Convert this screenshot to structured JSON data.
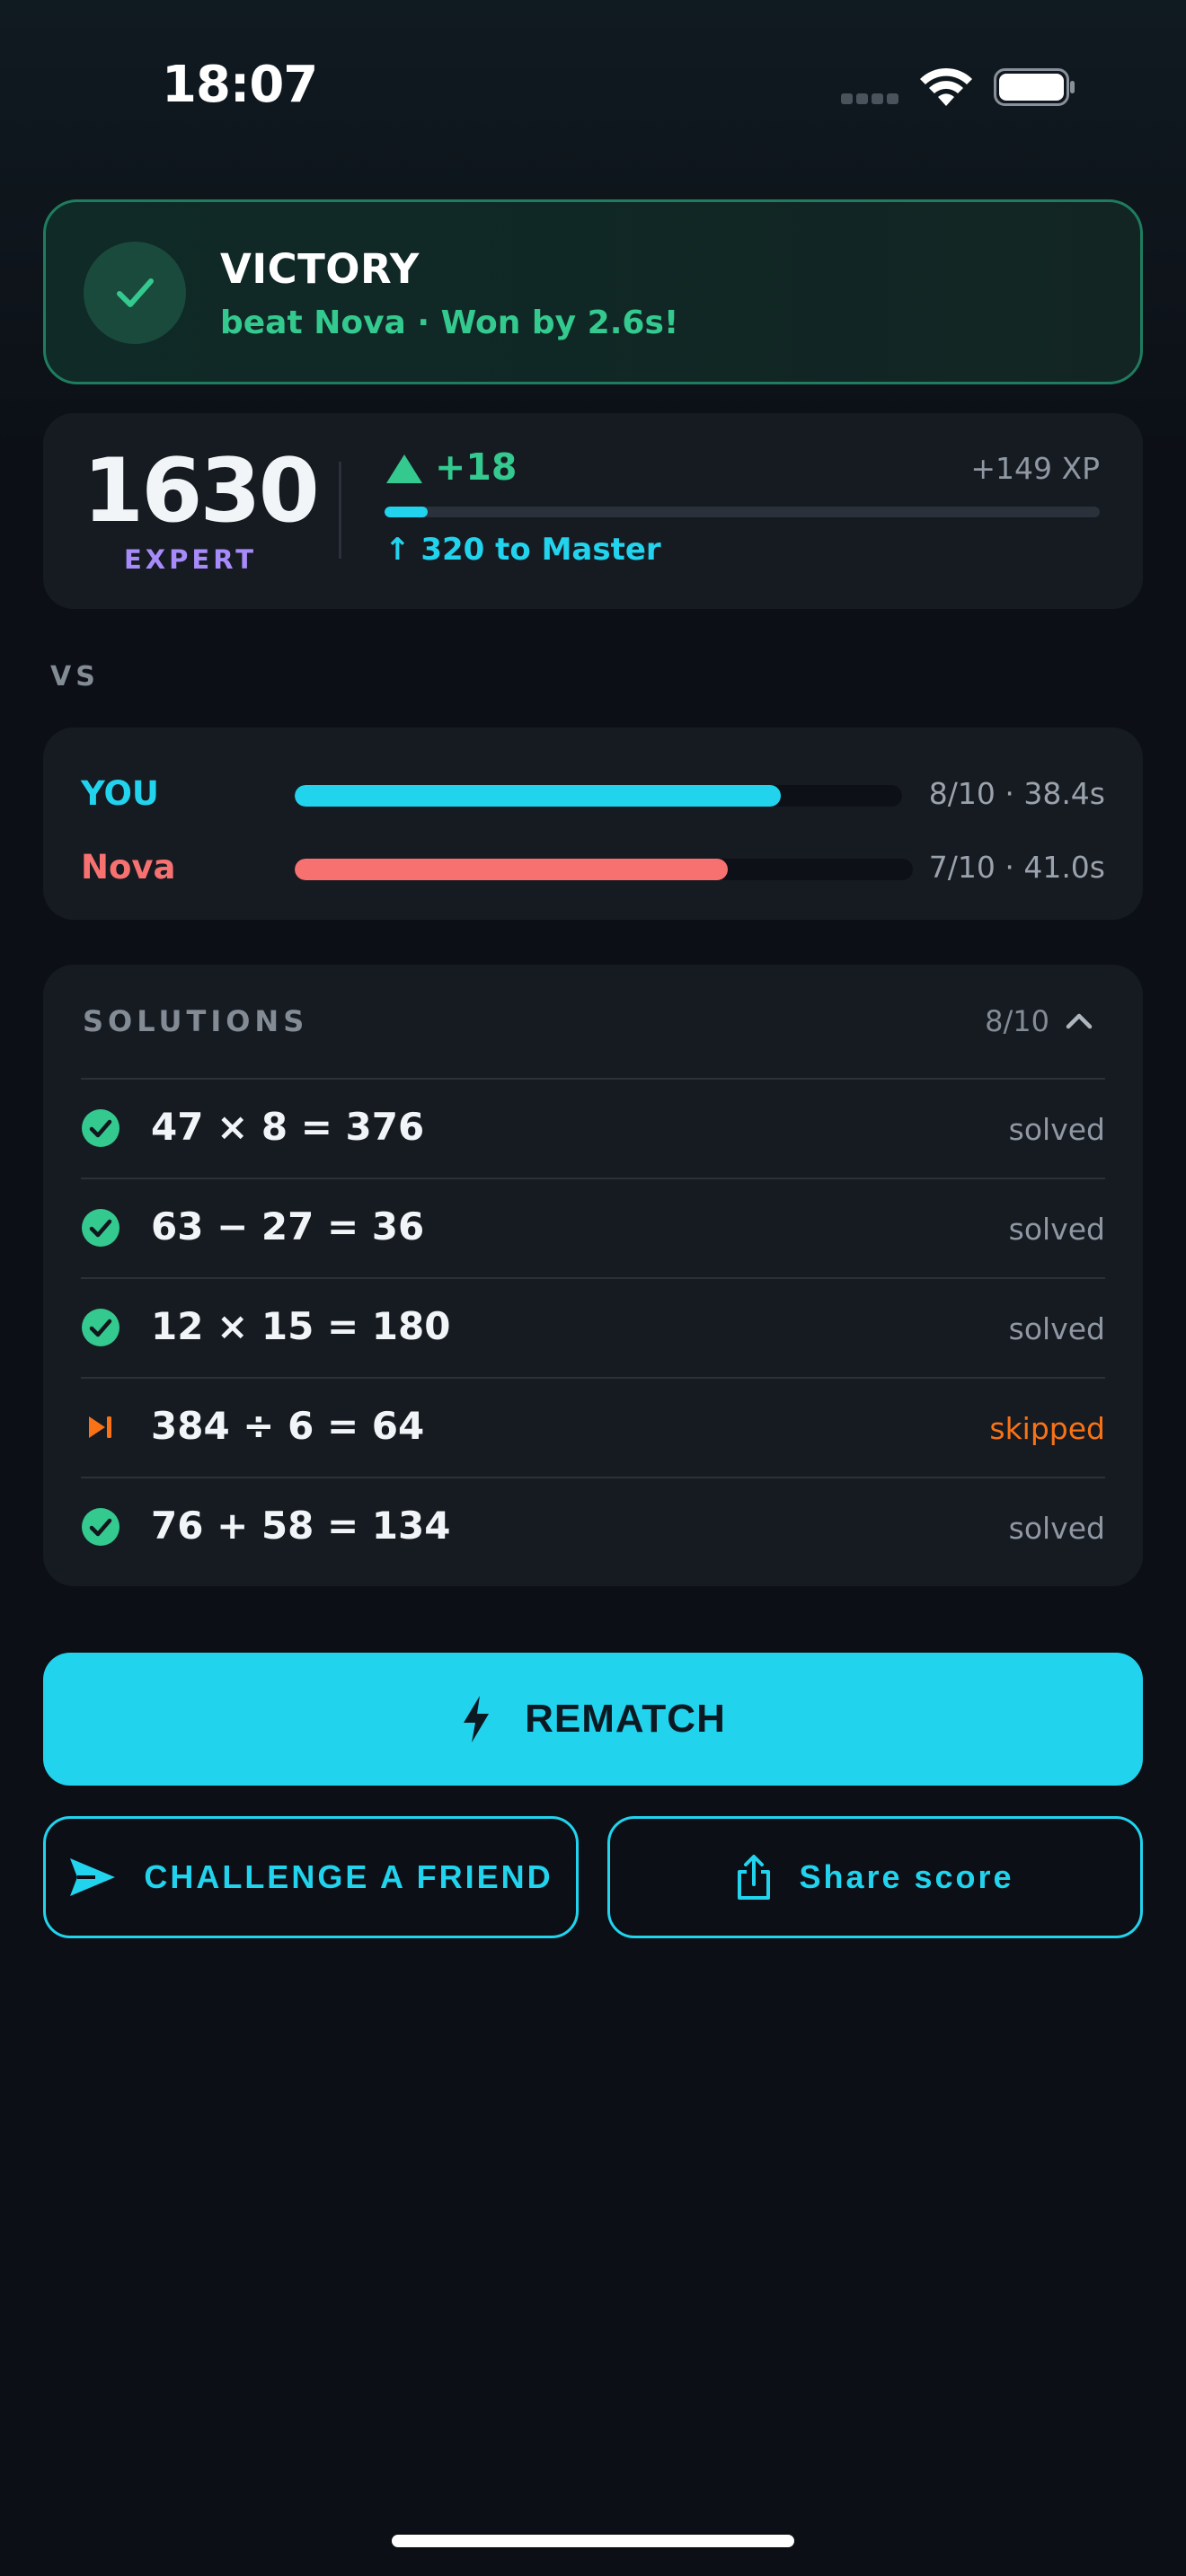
{
  "status_bar": {
    "time": "18:07"
  },
  "result": {
    "title": "VICTORY",
    "subtitle": "beat Nova · Won by 2.6s!",
    "icon": "check-icon"
  },
  "rating": {
    "value": "1630",
    "tier": "EXPERT",
    "delta": "+18",
    "xp": "+149 XP",
    "progress_to_next": 0.06,
    "next_tier_label": "↑ 320 to Master"
  },
  "versus": {
    "label": "VS",
    "players": [
      {
        "name": "YOU",
        "stat": "8/10 · 38.4s",
        "progress": 0.8,
        "color": "#22d3ee"
      },
      {
        "name": "Nova",
        "stat": "7/10 · 41.0s",
        "progress": 0.7,
        "color": "#f87171"
      }
    ]
  },
  "solutions": {
    "header": "SOLUTIONS",
    "count": "8/10",
    "items": [
      {
        "equation": "47 × 8 = 376",
        "status": "solved",
        "icon": "check-circle-icon"
      },
      {
        "equation": "63 − 27 = 36",
        "status": "solved",
        "icon": "check-circle-icon"
      },
      {
        "equation": "12 × 15 = 180",
        "status": "solved",
        "icon": "check-circle-icon"
      },
      {
        "equation": "384 ÷ 6 = 64",
        "status": "skipped",
        "icon": "skip-icon"
      },
      {
        "equation": "76 + 58 = 134",
        "status": "solved",
        "icon": "check-circle-icon"
      }
    ]
  },
  "actions": {
    "rematch": "REMATCH",
    "challenge": "CHALLENGE A FRIEND",
    "share": "Share score"
  },
  "colors": {
    "accent": "#22d3ee",
    "success": "#34c98e",
    "opponent": "#f87171",
    "skipped": "#f97316",
    "tier": "#a78bfa"
  }
}
